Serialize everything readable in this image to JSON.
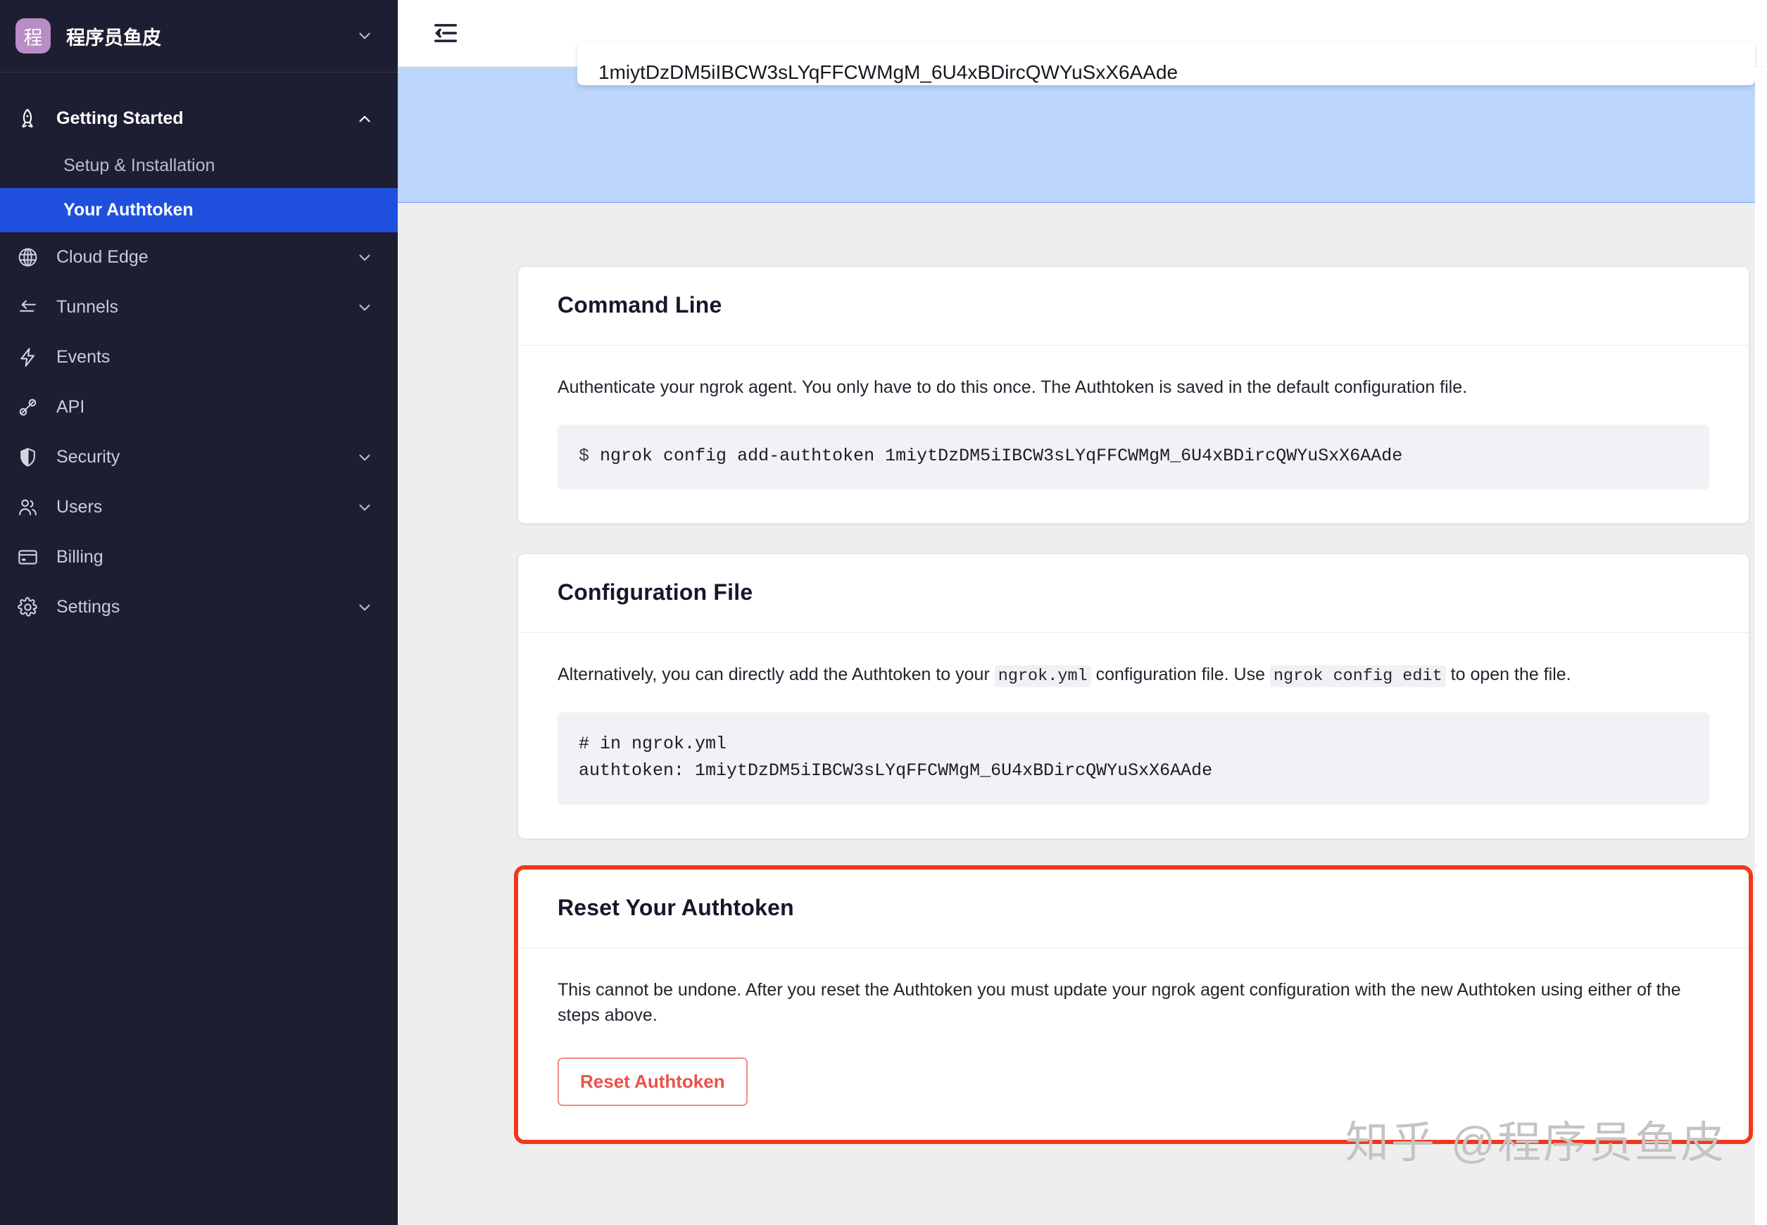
{
  "sidebar": {
    "org": {
      "avatar_text": "程",
      "avatar_color": "#b98cc6",
      "name": "程序员鱼皮",
      "chevron": "chevron-down-icon"
    },
    "groups": [
      {
        "label": "Getting Started",
        "icon": "rocket-icon",
        "expanded": true,
        "chevron": "chevron-up-icon",
        "items": [
          {
            "label": "Setup & Installation",
            "selected": false
          },
          {
            "label": "Your Authtoken",
            "selected": true
          }
        ]
      }
    ],
    "items": [
      {
        "label": "Cloud Edge",
        "icon": "globe-icon",
        "chevron": "chevron-down-icon"
      },
      {
        "label": "Tunnels",
        "icon": "tunnels-arrows-icon",
        "chevron": "chevron-down-icon"
      },
      {
        "label": "Events",
        "icon": "lightning-bolt-icon",
        "chevron": ""
      },
      {
        "label": "API",
        "icon": "plug-connector-icon",
        "chevron": ""
      },
      {
        "label": "Security",
        "icon": "shield-icon",
        "chevron": "chevron-down-icon"
      },
      {
        "label": "Users",
        "icon": "users-icon",
        "chevron": "chevron-down-icon"
      },
      {
        "label": "Billing",
        "icon": "credit-card-icon",
        "chevron": ""
      },
      {
        "label": "Settings",
        "icon": "gear-icon",
        "chevron": "chevron-down-icon"
      }
    ],
    "colors": {
      "background": "#1e1e32",
      "selected": "#1f50dd"
    }
  },
  "topbar": {
    "collapse_icon": "collapse-sidebar-icon"
  },
  "banner": {
    "background": "#bcd7fb",
    "token_value": "1miytDzDM5iIBCW3sLYqFFCWMgM_6U4xBDircQWYuSxX6AAde"
  },
  "cards": {
    "command_line": {
      "title": "Command Line",
      "paragraph": "Authenticate your ngrok agent. You only have to do this once. The Authtoken is saved in the default configuration file.",
      "code_prompt": "$",
      "code": "ngrok config add-authtoken 1miytDzDM5iIBCW3sLYqFFCWMgM_6U4xBDircQWYuSxX6AAde"
    },
    "configuration_file": {
      "title": "Configuration File",
      "text_part1": "Alternatively, you can directly add the Authtoken to your ",
      "code1": "ngrok.yml",
      "text_part2": " configuration file. Use ",
      "code2": "ngrok config edit",
      "text_part3": " to open the file.",
      "code_block": "# in ngrok.yml\nauthtoken: 1miytDzDM5iIBCW3sLYqFFCWMgM_6U4xBDircQWYuSxX6AAde"
    },
    "reset_authtoken": {
      "title": "Reset Your Authtoken",
      "paragraph": "This cannot be undone. After you reset the Authtoken you must update your ngrok agent configuration with the new Authtoken using either of the steps above.",
      "button_label": "Reset Authtoken",
      "highlight_color": "#f0381c",
      "button_text_color": "#e8534c"
    }
  },
  "watermark": {
    "text": "知乎 @程序员鱼皮"
  }
}
